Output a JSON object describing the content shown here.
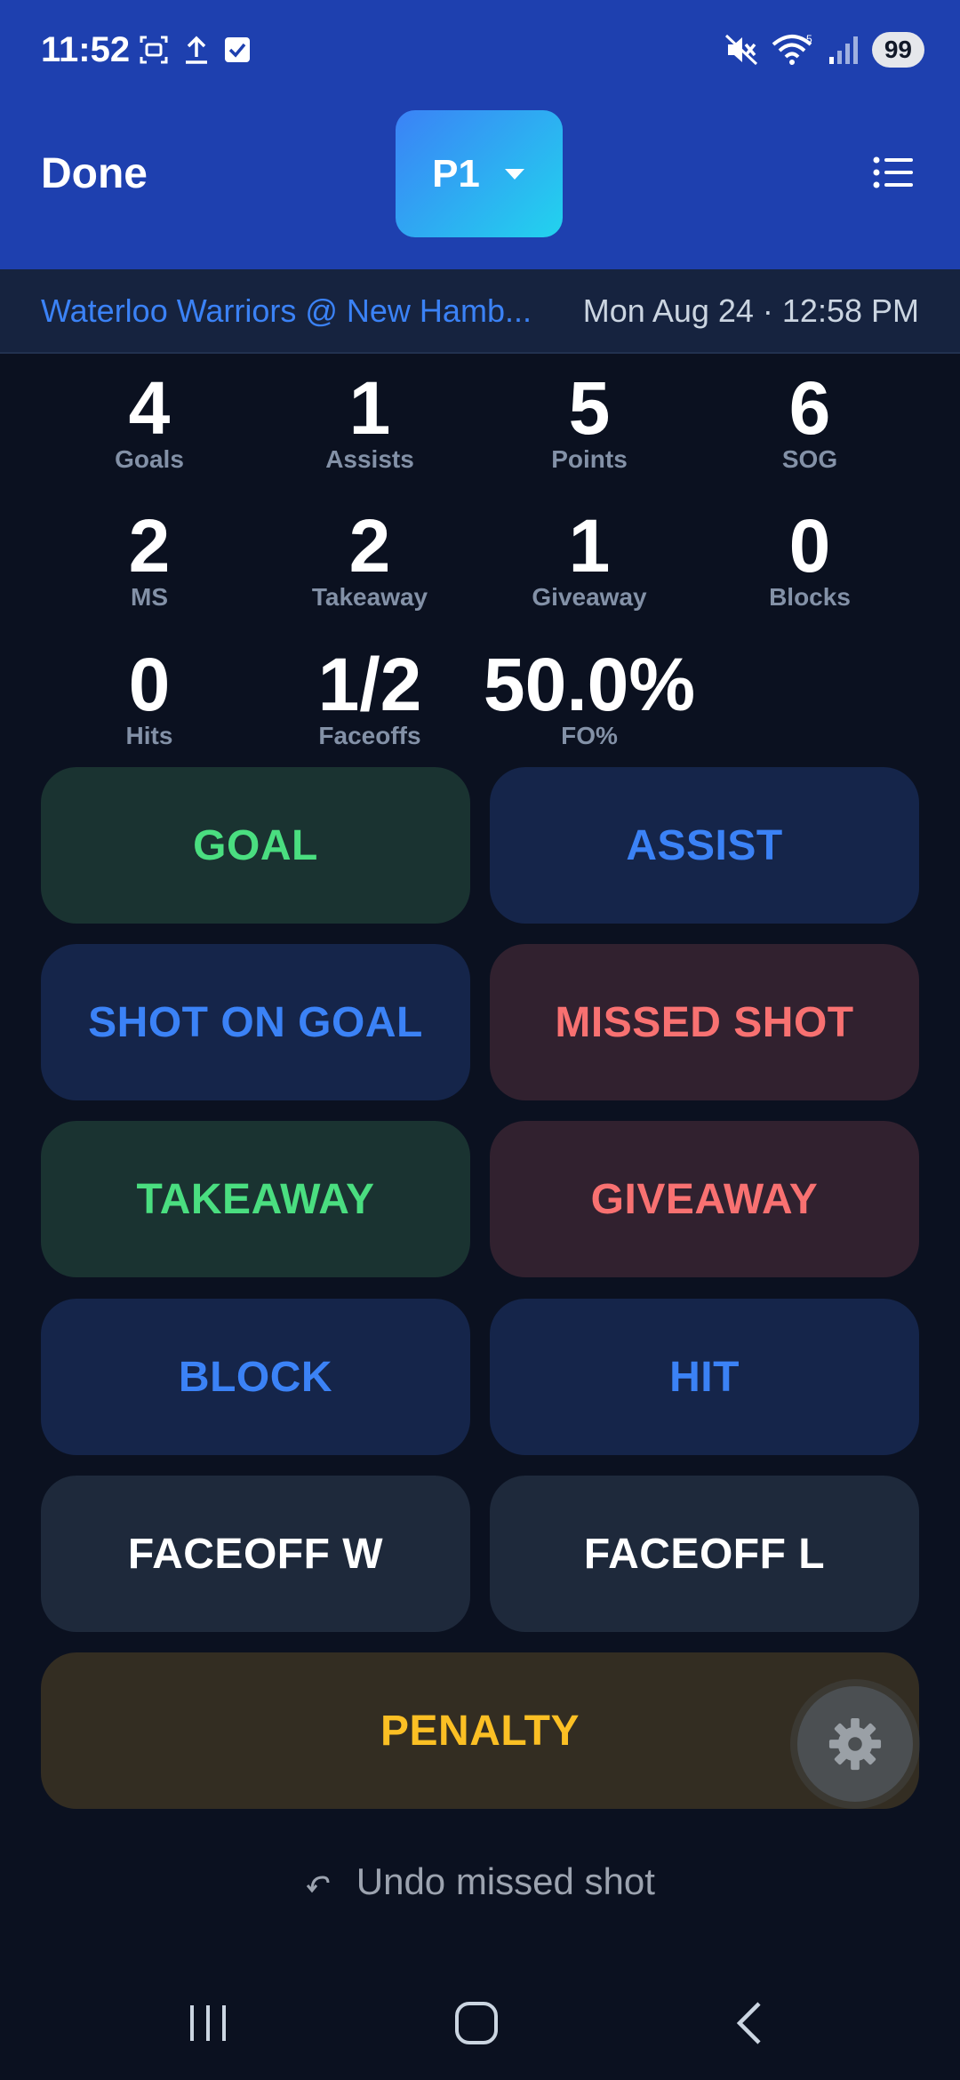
{
  "status_bar": {
    "time": "11:52",
    "battery": "99",
    "left_icons": [
      "screenshot-icon",
      "upload-icon",
      "checkbox-icon"
    ],
    "right_icons": [
      "mute-icon",
      "wifi-icon",
      "signal-icon"
    ]
  },
  "header": {
    "done_label": "Done",
    "period_label": "P1",
    "menu_icon": "list-icon"
  },
  "game": {
    "matchup": "Waterloo Warriors @ New Hamb...",
    "datetime": "Mon Aug 24 · 12:58 PM"
  },
  "stats": [
    {
      "value": "4",
      "label": "Goals"
    },
    {
      "value": "1",
      "label": "Assists"
    },
    {
      "value": "5",
      "label": "Points"
    },
    {
      "value": "6",
      "label": "SOG"
    },
    {
      "value": "2",
      "label": "MS"
    },
    {
      "value": "2",
      "label": "Takeaway"
    },
    {
      "value": "1",
      "label": "Giveaway"
    },
    {
      "value": "0",
      "label": "Blocks"
    },
    {
      "value": "0",
      "label": "Hits"
    },
    {
      "value": "1/2",
      "label": "Faceoffs"
    },
    {
      "value": "50.0%",
      "label": "FO%"
    }
  ],
  "actions": {
    "goal": "GOAL",
    "assist": "ASSIST",
    "shot_on_goal": "SHOT ON GOAL",
    "missed_shot": "MISSED SHOT",
    "takeaway": "TAKEAWAY",
    "giveaway": "GIVEAWAY",
    "block": "BLOCK",
    "hit": "HIT",
    "faceoff_w": "FACEOFF W",
    "faceoff_l": "FACEOFF L",
    "penalty": "PENALTY"
  },
  "undo": {
    "label": "Undo missed shot"
  },
  "colors": {
    "header_blue": "#1e40af",
    "background": "#0b1120",
    "green": "#4ade80",
    "blue": "#3b82f6",
    "red": "#f87171",
    "yellow": "#fbbf24"
  }
}
